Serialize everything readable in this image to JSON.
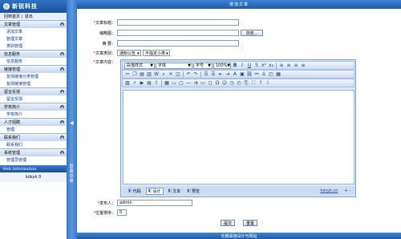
{
  "sidebar": {
    "brand": "新锐科技",
    "logo_glyph": "◎",
    "top_links": {
      "home": "回到首页",
      "sep": "|",
      "logout": "退出"
    },
    "sections": [
      {
        "title": "文章管理",
        "items": [
          "添加文章",
          "管理文章",
          "类别管理"
        ]
      },
      {
        "title": "信息服务",
        "items": [
          "信息服务"
        ]
      },
      {
        "title": "链接管理",
        "items": [
          "友情链接分类管理",
          "友情链接管理"
        ]
      },
      {
        "title": "留言反馈",
        "items": [
          "留言反馈"
        ]
      },
      {
        "title": "学校简介",
        "items": [
          "学校简介"
        ]
      },
      {
        "title": "人才招聘",
        "items": [
          "管理"
        ]
      },
      {
        "title": "联系我们",
        "items": [
          "联系我们"
        ]
      },
      {
        "title": "系统管理",
        "items": [
          "管理员管理"
        ]
      }
    ],
    "web_info": "Web Information",
    "user": "kdsyk 0"
  },
  "splitter": {
    "arrow": "◀",
    "label": "屏幕切换"
  },
  "main": {
    "header": "增加文章",
    "form": {
      "title_label": "文章标题：",
      "thumb_label": "缩略图：",
      "browse_label": "浏览...",
      "summary_label": "摘  要：",
      "category_label": "文章类别：",
      "category_value": "通知公告",
      "subcategory_value": "不指定小类",
      "content_label": "文章内容：",
      "publisher_label": "发布人：",
      "publisher_value": "admin",
      "order_label": "位置排序：",
      "order_value": "0",
      "submit_label": "提交",
      "reset_label": "重置",
      "required_mark": "*"
    },
    "editor": {
      "paragraph_select": "段落样式",
      "font_select": "字体",
      "size_select": "字号",
      "zoom_select": "100%",
      "modes": [
        {
          "icon": "◧",
          "label": "代码"
        },
        {
          "icon": "◧",
          "label": "设计"
        },
        {
          "icon": "◧",
          "label": "文本"
        },
        {
          "icon": "◧",
          "label": "预览"
        }
      ],
      "credit": "kdsyk.cn",
      "zoom_ctl": "+ -"
    },
    "footer": "长期承接设计与网站"
  },
  "colors": {
    "accent": "#1f5aa8",
    "link": "#003399",
    "required": "#ee0000"
  }
}
